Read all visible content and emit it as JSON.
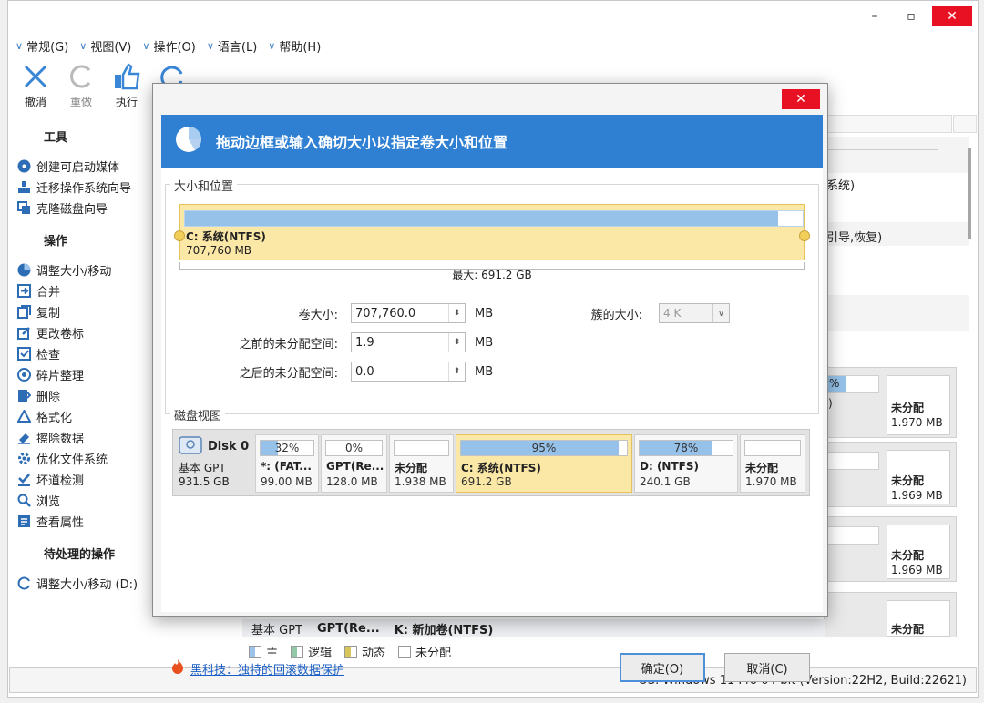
{
  "window": {
    "controls": {
      "minimize": "–",
      "maximize": "▫",
      "close": "✕"
    }
  },
  "menu": [
    {
      "label": "常规(G)"
    },
    {
      "label": "视图(V)"
    },
    {
      "label": "操作(O)"
    },
    {
      "label": "语言(L)"
    },
    {
      "label": "帮助(H)"
    }
  ],
  "toolbar": {
    "undo": "撤消",
    "redo": "重做",
    "apply": "执行",
    "redo2": "重"
  },
  "sidebar": {
    "tools_title": "工具",
    "tools": [
      "创建可启动媒体",
      "迁移操作系统向导",
      "克隆磁盘向导"
    ],
    "ops_title": "操作",
    "ops": [
      "调整大小/移动",
      "合并",
      "复制",
      "更改卷标",
      "检查",
      "碎片整理",
      "删除",
      "格式化",
      "擦除数据",
      "优化文件系统",
      "坏道检测",
      "浏览",
      "查看属性"
    ],
    "pending_title": "待处理的操作",
    "pending": [
      "调整大小/移动 (D:)"
    ]
  },
  "background": {
    "text1": "系统)",
    "text2": "引导,恢复)",
    "pct": "%",
    "paren": ")",
    "unalloc": "未分配",
    "sizes": [
      "1.970 MB",
      "1.969 MB",
      "1.969 MB"
    ],
    "bottom": {
      "basic": "基本 GPT",
      "gpt": "GPT(Re...",
      "k": "K: 新加卷(NTFS)"
    }
  },
  "legend": {
    "primary": "主",
    "logical": "逻辑",
    "dynamic": "动态",
    "unalloc": "未分配"
  },
  "status": "OS: Windows 11 Pro 64-bit (Version:22H2, Build:22621)",
  "dialog": {
    "close": "✕",
    "title": "拖动边框或输入确切大小以指定卷大小和位置",
    "group1": "大小和位置",
    "partition": {
      "name": "C: 系统(NTFS)",
      "size": "707,760 MB",
      "fill_pct": 96
    },
    "max": "最大: 691.2 GB",
    "fields": {
      "vol_size_label": "卷大小:",
      "vol_size": "707,760.0",
      "before_label": "之前的未分配空间:",
      "before": "1.9",
      "after_label": "之后的未分配空间:",
      "after": "0.0",
      "unit": "MB",
      "cluster_label": "簇的大小:",
      "cluster": "4 K"
    },
    "group2": "磁盘视图",
    "disk": {
      "name": "Disk 0",
      "type": "基本 GPT",
      "size": "931.5 GB"
    },
    "parts": [
      {
        "pct": "32%",
        "fill": 32,
        "name": "*: (FAT...",
        "size": "99.00 MB"
      },
      {
        "pct": "0%",
        "fill": 0,
        "name": "GPT(Re...",
        "size": "128.0 MB"
      },
      {
        "pct": "",
        "fill": 0,
        "name": "未分配",
        "size": "1.938 MB"
      },
      {
        "pct": "95%",
        "fill": 95,
        "name": "C: 系统(NTFS)",
        "size": "691.2 GB"
      },
      {
        "pct": "78%",
        "fill": 78,
        "name": "D: (NTFS)",
        "size": "240.1 GB"
      },
      {
        "pct": "",
        "fill": 0,
        "name": "未分配",
        "size": "1.970 MB"
      }
    ],
    "hint": "黑科技：独特的回滚数据保护",
    "ok": "确定(O)",
    "cancel": "取消(C)"
  },
  "colors": {
    "accent": "#2f7fd3",
    "selected": "#fbe7a6",
    "fill": "#96c2ea",
    "close": "#e81123"
  }
}
